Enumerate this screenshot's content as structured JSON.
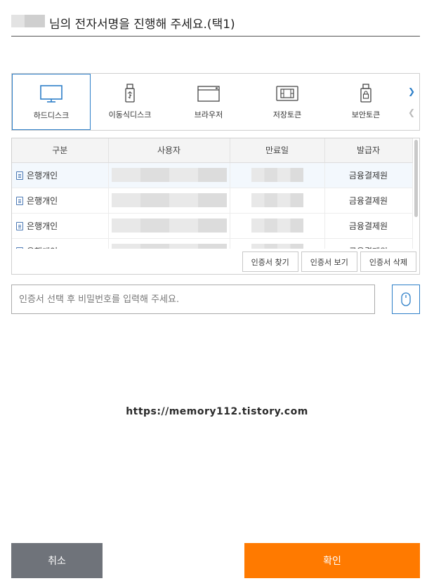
{
  "header": {
    "title": "님의 전자서명을 진행해 주세요.(택1)"
  },
  "storage": {
    "items": [
      {
        "label": "하드디스크",
        "icon": "monitor-icon"
      },
      {
        "label": "이동식디스크",
        "icon": "usb-icon"
      },
      {
        "label": "브라우저",
        "icon": "browser-icon"
      },
      {
        "label": "저장토큰",
        "icon": "token-icon"
      },
      {
        "label": "보안토큰",
        "icon": "lock-usb-icon"
      }
    ],
    "active": "하드디스크"
  },
  "cert_table": {
    "columns": [
      "구분",
      "사용자",
      "만료일",
      "발급자"
    ],
    "rows": [
      {
        "type": "은행개인",
        "issuer": "금융결제원"
      },
      {
        "type": "은행개인",
        "issuer": "금융결제원"
      },
      {
        "type": "은행개인",
        "issuer": "금융결제원"
      },
      {
        "type": "은행개인",
        "issuer": "금융결제원"
      }
    ]
  },
  "cert_buttons": {
    "find": "인증서 찾기",
    "view": "인증서 보기",
    "delete": "인증서 삭제"
  },
  "password": {
    "placeholder": "인증서 선택 후 비밀번호를 입력해 주세요."
  },
  "watermark": "https://memory112.tistory.com",
  "actions": {
    "cancel": "취소",
    "confirm": "확인"
  },
  "colors": {
    "accent": "#2d7fc8",
    "confirm": "#ff7a00",
    "cancel": "#6f737a"
  }
}
